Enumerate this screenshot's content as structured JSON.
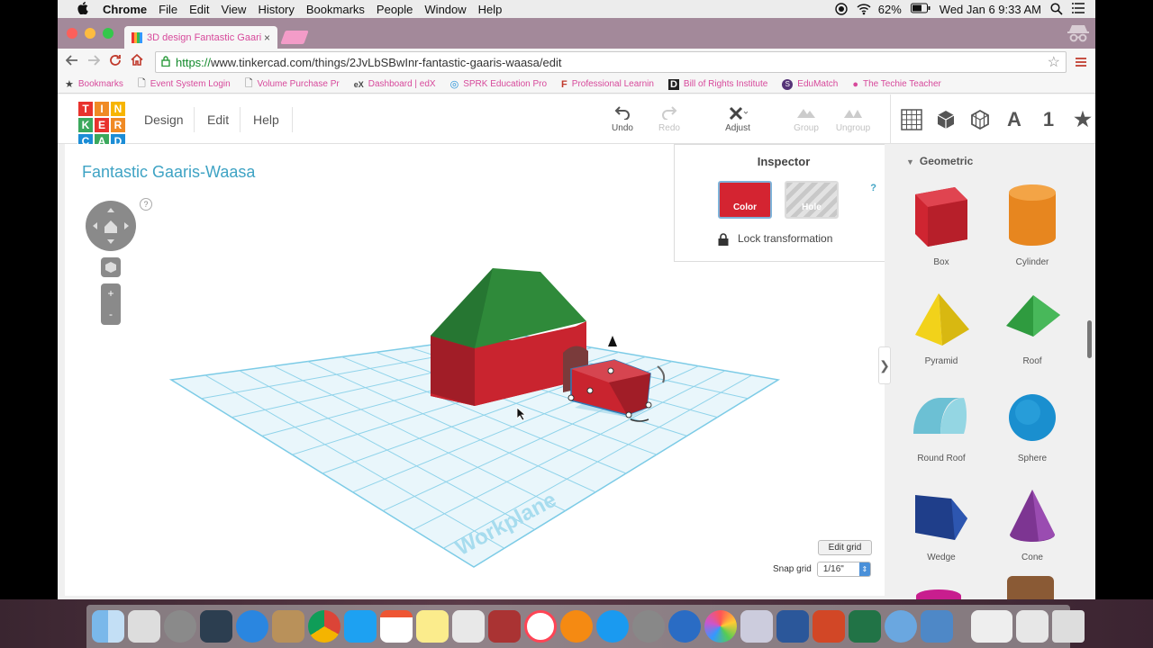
{
  "menubar": {
    "app_name": "Chrome",
    "items": [
      "File",
      "Edit",
      "View",
      "History",
      "Bookmarks",
      "People",
      "Window",
      "Help"
    ],
    "battery": "62%",
    "clock": "Wed Jan 6  9:33 AM"
  },
  "browser": {
    "tab_title": "3D design Fantastic Gaari",
    "tab_close": "×",
    "url_protocol": "https://",
    "url_rest": "www.tinkercad.com/things/2JvLbSBwInr-fantastic-gaaris-waasa/edit",
    "bookmarks": [
      {
        "label": "Bookmarks",
        "icon": "star-icon"
      },
      {
        "label": "Event System Login",
        "icon": "page-icon"
      },
      {
        "label": "Volume Purchase Pr",
        "icon": "page-icon"
      },
      {
        "label": "Dashboard | edX",
        "icon": "edx-icon"
      },
      {
        "label": "SPRK Education Pro",
        "icon": "sprk-icon"
      },
      {
        "label": "Professional Learnin",
        "icon": "pl-icon"
      },
      {
        "label": "Bill of Rights Institute",
        "icon": "d-icon"
      },
      {
        "label": "EduMatch",
        "icon": "s-icon"
      },
      {
        "label": "The Techie Teacher",
        "icon": "apple-icon"
      }
    ]
  },
  "tinkercad": {
    "logo_letters": [
      "T",
      "I",
      "N",
      "K",
      "E",
      "R",
      "C",
      "A",
      "D"
    ],
    "logo_colors": [
      "#e8322d",
      "#f08a24",
      "#f7b500",
      "#3ba85c",
      "#e8322d",
      "#f08a24",
      "#1c8dd6",
      "#3ba85c",
      "#1c8dd6"
    ],
    "menu": [
      "Design",
      "Edit",
      "Help"
    ],
    "tools": {
      "undo": "Undo",
      "redo": "Redo",
      "adjust": "Adjust",
      "group": "Group",
      "ungroup": "Ungroup"
    },
    "lib_letter": "A",
    "lib_number": "1",
    "project_title": "Fantastic Gaaris-Waasa",
    "help_mark": "?",
    "zoom_in": "+",
    "zoom_out": "-",
    "inspector": {
      "title": "Inspector",
      "help": "?",
      "color_label": "Color",
      "hole_label": "Hole",
      "lock_label": "Lock transformation"
    },
    "workplane_label": "Workplane",
    "edit_grid": "Edit grid",
    "snap_grid_label": "Snap grid",
    "snap_grid_value": "1/16\"",
    "collapse_arrow": "❯",
    "sidebar": {
      "heading": "Geometric",
      "shapes": [
        {
          "name": "Box",
          "color": "#cf2531"
        },
        {
          "name": "Cylinder",
          "color": "#e7861f"
        },
        {
          "name": "Pyramid",
          "color": "#f2d21a"
        },
        {
          "name": "Roof",
          "color": "#2f9b3f"
        },
        {
          "name": "Round Roof",
          "color": "#6cc0d4"
        },
        {
          "name": "Sphere",
          "color": "#1a8fcf"
        },
        {
          "name": "Wedge",
          "color": "#1f3e8a"
        },
        {
          "name": "Cone",
          "color": "#7d3592"
        }
      ]
    }
  },
  "colors": {
    "accent": "#3ea3c4",
    "house_body": "#c9242f",
    "house_roof": "#2f8a3a",
    "grid_line": "#7ccbe6"
  }
}
